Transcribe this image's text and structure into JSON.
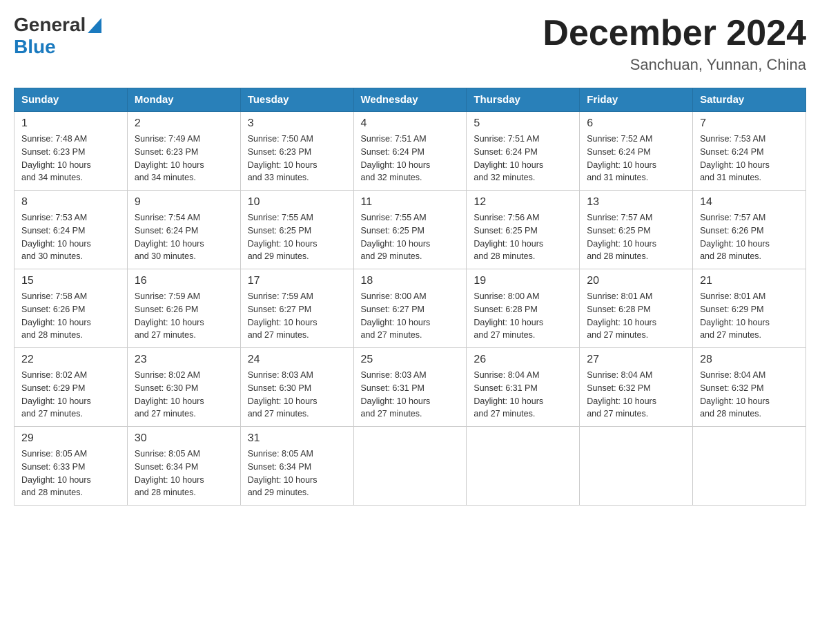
{
  "header": {
    "logo_general": "General",
    "logo_blue": "Blue",
    "month_title": "December 2024",
    "location": "Sanchuan, Yunnan, China"
  },
  "days_of_week": [
    "Sunday",
    "Monday",
    "Tuesday",
    "Wednesday",
    "Thursday",
    "Friday",
    "Saturday"
  ],
  "weeks": [
    [
      {
        "day": "1",
        "sunrise": "7:48 AM",
        "sunset": "6:23 PM",
        "daylight": "10 hours and 34 minutes."
      },
      {
        "day": "2",
        "sunrise": "7:49 AM",
        "sunset": "6:23 PM",
        "daylight": "10 hours and 34 minutes."
      },
      {
        "day": "3",
        "sunrise": "7:50 AM",
        "sunset": "6:23 PM",
        "daylight": "10 hours and 33 minutes."
      },
      {
        "day": "4",
        "sunrise": "7:51 AM",
        "sunset": "6:24 PM",
        "daylight": "10 hours and 32 minutes."
      },
      {
        "day": "5",
        "sunrise": "7:51 AM",
        "sunset": "6:24 PM",
        "daylight": "10 hours and 32 minutes."
      },
      {
        "day": "6",
        "sunrise": "7:52 AM",
        "sunset": "6:24 PM",
        "daylight": "10 hours and 31 minutes."
      },
      {
        "day": "7",
        "sunrise": "7:53 AM",
        "sunset": "6:24 PM",
        "daylight": "10 hours and 31 minutes."
      }
    ],
    [
      {
        "day": "8",
        "sunrise": "7:53 AM",
        "sunset": "6:24 PM",
        "daylight": "10 hours and 30 minutes."
      },
      {
        "day": "9",
        "sunrise": "7:54 AM",
        "sunset": "6:24 PM",
        "daylight": "10 hours and 30 minutes."
      },
      {
        "day": "10",
        "sunrise": "7:55 AM",
        "sunset": "6:25 PM",
        "daylight": "10 hours and 29 minutes."
      },
      {
        "day": "11",
        "sunrise": "7:55 AM",
        "sunset": "6:25 PM",
        "daylight": "10 hours and 29 minutes."
      },
      {
        "day": "12",
        "sunrise": "7:56 AM",
        "sunset": "6:25 PM",
        "daylight": "10 hours and 28 minutes."
      },
      {
        "day": "13",
        "sunrise": "7:57 AM",
        "sunset": "6:25 PM",
        "daylight": "10 hours and 28 minutes."
      },
      {
        "day": "14",
        "sunrise": "7:57 AM",
        "sunset": "6:26 PM",
        "daylight": "10 hours and 28 minutes."
      }
    ],
    [
      {
        "day": "15",
        "sunrise": "7:58 AM",
        "sunset": "6:26 PM",
        "daylight": "10 hours and 28 minutes."
      },
      {
        "day": "16",
        "sunrise": "7:59 AM",
        "sunset": "6:26 PM",
        "daylight": "10 hours and 27 minutes."
      },
      {
        "day": "17",
        "sunrise": "7:59 AM",
        "sunset": "6:27 PM",
        "daylight": "10 hours and 27 minutes."
      },
      {
        "day": "18",
        "sunrise": "8:00 AM",
        "sunset": "6:27 PM",
        "daylight": "10 hours and 27 minutes."
      },
      {
        "day": "19",
        "sunrise": "8:00 AM",
        "sunset": "6:28 PM",
        "daylight": "10 hours and 27 minutes."
      },
      {
        "day": "20",
        "sunrise": "8:01 AM",
        "sunset": "6:28 PM",
        "daylight": "10 hours and 27 minutes."
      },
      {
        "day": "21",
        "sunrise": "8:01 AM",
        "sunset": "6:29 PM",
        "daylight": "10 hours and 27 minutes."
      }
    ],
    [
      {
        "day": "22",
        "sunrise": "8:02 AM",
        "sunset": "6:29 PM",
        "daylight": "10 hours and 27 minutes."
      },
      {
        "day": "23",
        "sunrise": "8:02 AM",
        "sunset": "6:30 PM",
        "daylight": "10 hours and 27 minutes."
      },
      {
        "day": "24",
        "sunrise": "8:03 AM",
        "sunset": "6:30 PM",
        "daylight": "10 hours and 27 minutes."
      },
      {
        "day": "25",
        "sunrise": "8:03 AM",
        "sunset": "6:31 PM",
        "daylight": "10 hours and 27 minutes."
      },
      {
        "day": "26",
        "sunrise": "8:04 AM",
        "sunset": "6:31 PM",
        "daylight": "10 hours and 27 minutes."
      },
      {
        "day": "27",
        "sunrise": "8:04 AM",
        "sunset": "6:32 PM",
        "daylight": "10 hours and 27 minutes."
      },
      {
        "day": "28",
        "sunrise": "8:04 AM",
        "sunset": "6:32 PM",
        "daylight": "10 hours and 28 minutes."
      }
    ],
    [
      {
        "day": "29",
        "sunrise": "8:05 AM",
        "sunset": "6:33 PM",
        "daylight": "10 hours and 28 minutes."
      },
      {
        "day": "30",
        "sunrise": "8:05 AM",
        "sunset": "6:34 PM",
        "daylight": "10 hours and 28 minutes."
      },
      {
        "day": "31",
        "sunrise": "8:05 AM",
        "sunset": "6:34 PM",
        "daylight": "10 hours and 29 minutes."
      },
      null,
      null,
      null,
      null
    ]
  ],
  "labels": {
    "sunrise": "Sunrise:",
    "sunset": "Sunset:",
    "daylight": "Daylight:"
  }
}
